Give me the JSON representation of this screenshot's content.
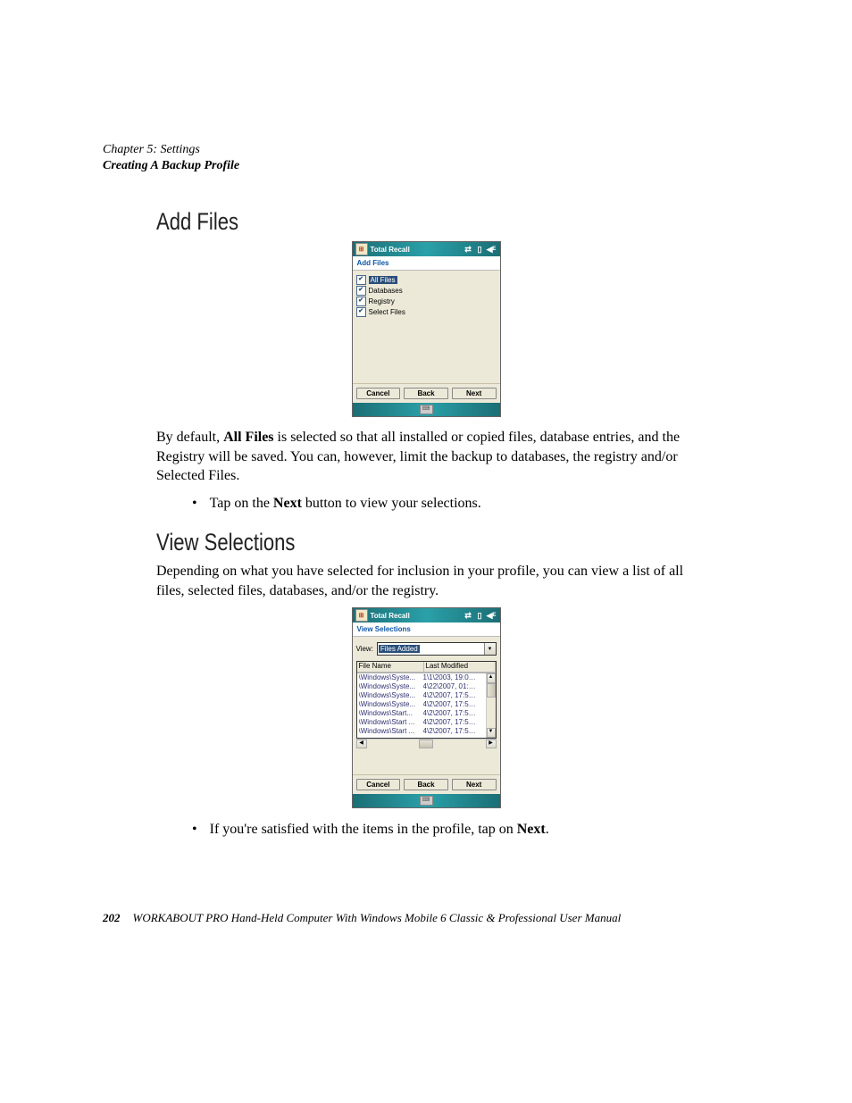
{
  "chapterLine": "Chapter  5:  Settings",
  "sectionLine": "Creating A Backup Profile",
  "heading1": "Add  Files",
  "heading2": "View  Selections",
  "para1": {
    "pre": "By default, ",
    "bold": "All Files",
    "post": " is selected so that all installed or copied files, database entries, and the Registry will be saved. You can, however, limit the backup to databases, the registry and/or Selected Files."
  },
  "bullet1": {
    "pre": "Tap on the ",
    "bold": "Next",
    "post": " button to view your selections."
  },
  "para2": "Depending on what you have selected for inclusion in your profile, you can view a list of all files, selected files, databases, and/or the registry.",
  "bullet2": {
    "pre": "If you're satisfied with the items in the profile, tap on ",
    "bold": "Next",
    "post": "."
  },
  "fig1": {
    "title": "Total Recall",
    "subtitle": "Add Files",
    "checkItems": [
      {
        "label": "All Files",
        "checked": true,
        "selected": true
      },
      {
        "label": "Databases",
        "checked": true,
        "selected": false
      },
      {
        "label": "Registry",
        "checked": true,
        "selected": false
      },
      {
        "label": "Select Files",
        "checked": true,
        "selected": false
      }
    ],
    "buttons": {
      "cancel": "Cancel",
      "back": "Back",
      "next": "Next"
    }
  },
  "fig2": {
    "title": "Total Recall",
    "subtitle": "View Selections",
    "viewLabel": "View:",
    "viewValue": "Files Added",
    "columns": {
      "c1": "File Name",
      "c2": "Last Modified"
    },
    "rows": [
      {
        "name": "\\Windows\\Syste...",
        "date": "1\\1\\2003, 19:0…"
      },
      {
        "name": "\\Windows\\Syste...",
        "date": "4\\22\\2007, 01:…"
      },
      {
        "name": "\\Windows\\Syste...",
        "date": "4\\2\\2007, 17:5…"
      },
      {
        "name": "\\Windows\\Syste...",
        "date": "4\\2\\2007, 17:5…"
      },
      {
        "name": "\\Windows\\Start...",
        "date": "4\\2\\2007, 17:5…"
      },
      {
        "name": "\\Windows\\Start ...",
        "date": "4\\2\\2007, 17:5…"
      },
      {
        "name": "\\Windows\\Start ...",
        "date": "4\\2\\2007, 17:5…"
      }
    ],
    "buttons": {
      "cancel": "Cancel",
      "back": "Back",
      "next": "Next"
    }
  },
  "footer": {
    "page": "202",
    "text": "WORKABOUT PRO Hand-Held Computer With Windows Mobile 6 Classic & Professional User Manual"
  }
}
